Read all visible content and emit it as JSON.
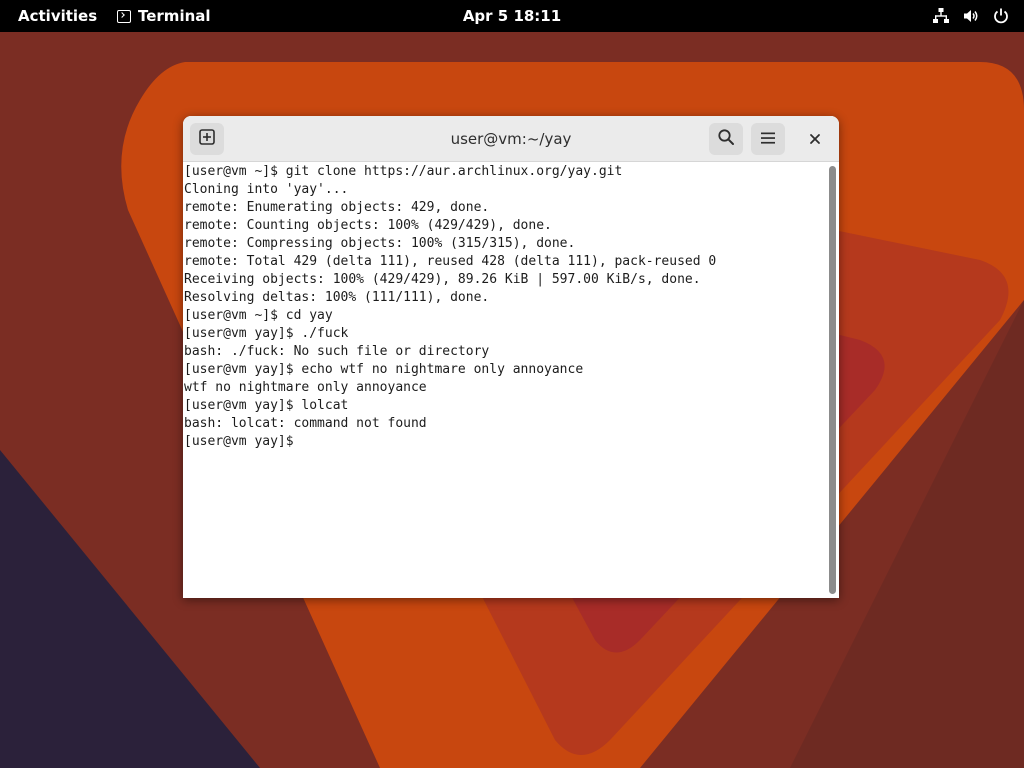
{
  "topbar": {
    "activities_label": "Activities",
    "app_name": "Terminal",
    "clock": "Apr 5  18:11"
  },
  "window": {
    "title": "user@vm:~/yay"
  },
  "terminal": {
    "lines": [
      "[user@vm ~]$ git clone https://aur.archlinux.org/yay.git",
      "Cloning into 'yay'...",
      "remote: Enumerating objects: 429, done.",
      "remote: Counting objects: 100% (429/429), done.",
      "remote: Compressing objects: 100% (315/315), done.",
      "remote: Total 429 (delta 111), reused 428 (delta 111), pack-reused 0",
      "Receiving objects: 100% (429/429), 89.26 KiB | 597.00 KiB/s, done.",
      "Resolving deltas: 100% (111/111), done.",
      "[user@vm ~]$ cd yay",
      "[user@vm yay]$ ./fuck",
      "bash: ./fuck: No such file or directory",
      "[user@vm yay]$ echo wtf no nightmare only annoyance",
      "wtf no nightmare only annoyance",
      "[user@vm yay]$ lolcat",
      "bash: lolcat: command not found",
      "[user@vm yay]$ "
    ]
  },
  "icons": {
    "app_menu": "terminal-icon",
    "network": "network-wired-icon",
    "volume": "volume-icon",
    "power": "power-icon",
    "new_tab": "new-tab-icon",
    "search": "search-icon",
    "menu": "hamburger-menu-icon",
    "close": "close-icon"
  },
  "colors": {
    "topbar_bg": "#000000",
    "wallpaper_base": "#7a2c22",
    "wallpaper_orange": "#c9440f",
    "wallpaper_dark": "#2a1f3a",
    "terminal_bg": "#ffffff",
    "terminal_fg": "#1c1c1c",
    "headerbar_bg": "#ebebeb"
  }
}
